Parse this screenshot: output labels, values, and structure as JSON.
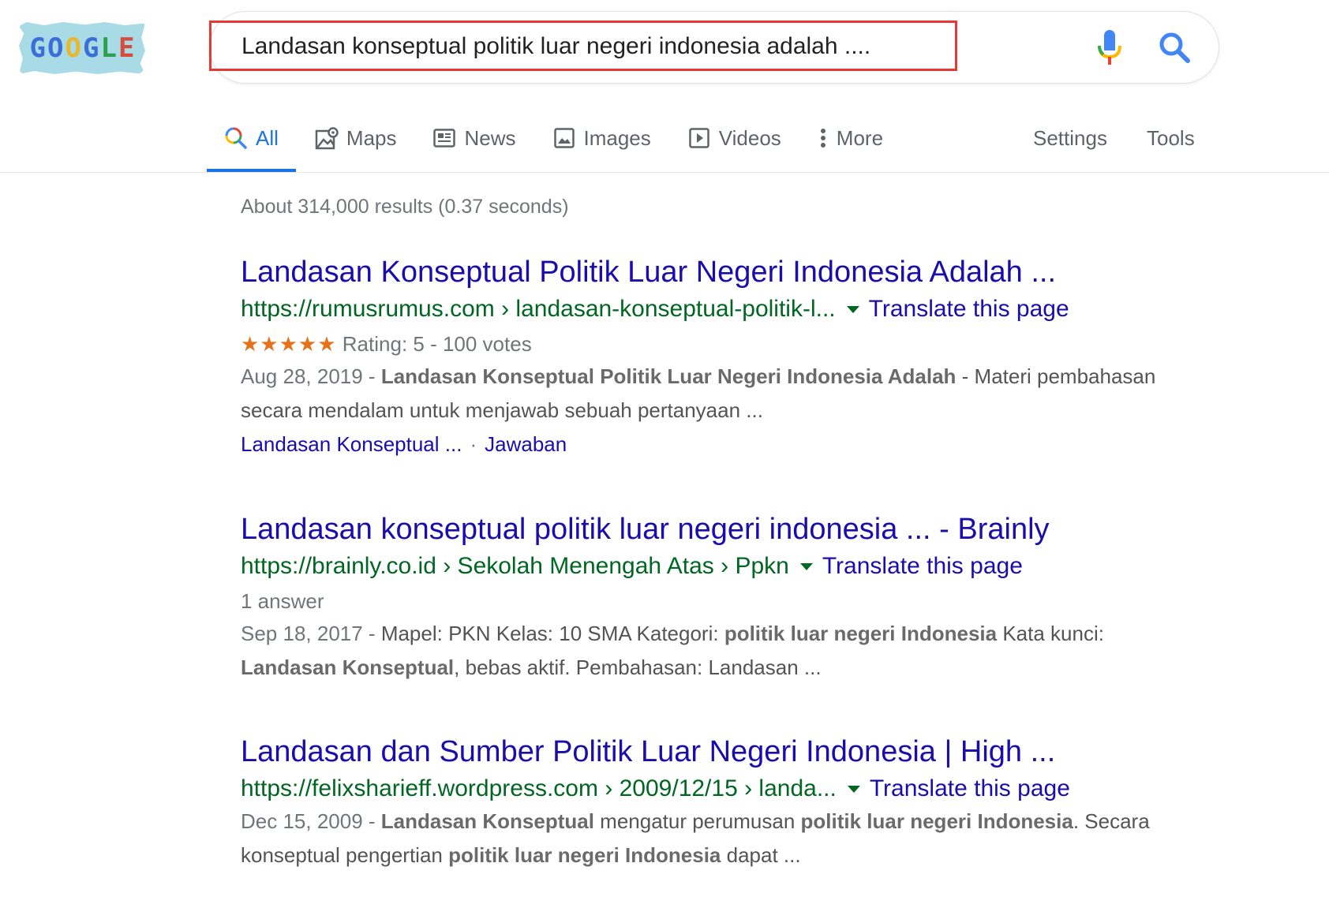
{
  "logo": {
    "letters": [
      "G",
      "O",
      "O",
      "G",
      "L",
      "E"
    ],
    "colors": [
      "#3a6fd8",
      "#3a6fd8",
      "#e8b830",
      "#3a6fd8",
      "#2e9e4f",
      "#d84a3a"
    ]
  },
  "search": {
    "query": "Landasan konseptual politik luar negeri indonesia adalah ....",
    "mic_icon": "mic-icon",
    "search_icon": "search-icon"
  },
  "tabs": [
    {
      "label": "All",
      "icon": "search-icon",
      "active": true
    },
    {
      "label": "Maps",
      "icon": "map-pin-icon"
    },
    {
      "label": "News",
      "icon": "newspaper-icon"
    },
    {
      "label": "Images",
      "icon": "image-icon"
    },
    {
      "label": "Videos",
      "icon": "play-icon"
    },
    {
      "label": "More",
      "icon": "more-vertical-icon"
    }
  ],
  "tools": {
    "settings": "Settings",
    "tools": "Tools"
  },
  "stats": "About 314,000 results (0.37 seconds)",
  "results": [
    {
      "title": "Landasan Konseptual Politik Luar Negeri Indonesia Adalah ...",
      "url": "https://rumusrumus.com › landasan-konseptual-politik-l...",
      "translate": "Translate this page",
      "stars": "★★★★★",
      "rating": "Rating: 5 - 100 votes",
      "date": "Aug 28, 2019 - ",
      "snippet_bold": "Landasan Konseptual Politik Luar Negeri Indonesia Adalah",
      "snippet_rest": " - Materi pembahasan secara mendalam untuk menjawab sebuah pertanyaan ...",
      "sitelinks": [
        "Landasan Konseptual ...",
        "Jawaban"
      ],
      "sitelink_sep": "·"
    },
    {
      "title": "Landasan konseptual politik luar negeri indonesia ... - Brainly",
      "url": "https://brainly.co.id › Sekolah Menengah Atas › Ppkn",
      "translate": "Translate this page",
      "meta": "1 answer",
      "date": "Sep 18, 2017 - ",
      "snippet_a": "Mapel: PKN Kelas: 10 SMA Kategori: ",
      "snippet_b1": "politik luar negeri Indonesia",
      "snippet_c": " Kata kunci: ",
      "snippet_b2": "Landasan Konseptual",
      "snippet_d": ", bebas aktif. Pembahasan: Landasan ..."
    },
    {
      "title": "Landasan dan Sumber Politik Luar Negeri Indonesia | High ...",
      "url": "https://felixsharieff.wordpress.com › 2009/12/15 › landa...",
      "translate": "Translate this page",
      "date": "Dec 15, 2009 - ",
      "snippet_b1": "Landasan Konseptual",
      "snippet_a": " mengatur perumusan ",
      "snippet_b2": "politik luar negeri Indonesia",
      "snippet_c": ". Secara konseptual pengertian ",
      "snippet_b3": "politik luar negeri Indonesia",
      "snippet_d": " dapat ..."
    }
  ]
}
